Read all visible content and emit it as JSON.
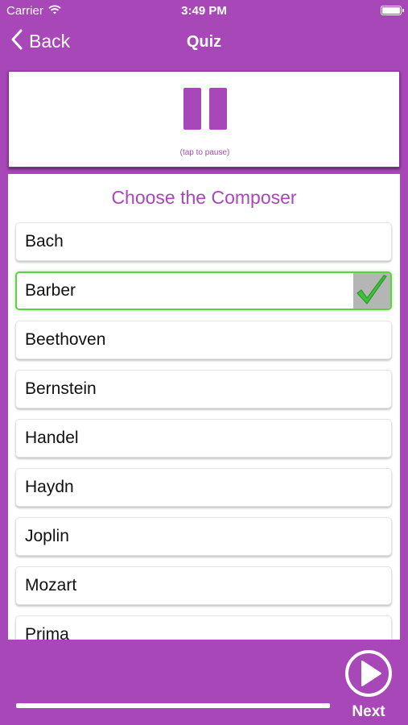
{
  "status_bar": {
    "carrier": "Carrier",
    "time": "3:49 PM"
  },
  "nav": {
    "back_label": "Back",
    "title": "Quiz"
  },
  "player": {
    "hint": "(tap to pause)"
  },
  "quiz": {
    "heading": "Choose the Composer",
    "options": [
      {
        "label": "Bach"
      },
      {
        "label": "Barber",
        "selected": true,
        "status": "correct"
      },
      {
        "label": "Beethoven"
      },
      {
        "label": "Bernstein"
      },
      {
        "label": "Handel"
      },
      {
        "label": "Haydn"
      },
      {
        "label": "Joplin"
      },
      {
        "label": "Mozart"
      },
      {
        "label": "Prima"
      }
    ]
  },
  "footer": {
    "next_label": "Next",
    "progress": 1.0
  },
  "colors": {
    "accent": "#a847b8",
    "correct": "#3cc23a",
    "check_bg": "#b5b5b5"
  },
  "icons": {
    "back": "chevron-left-icon",
    "pause": "pause-icon",
    "check": "checkmark-icon",
    "next": "play-circle-icon"
  }
}
